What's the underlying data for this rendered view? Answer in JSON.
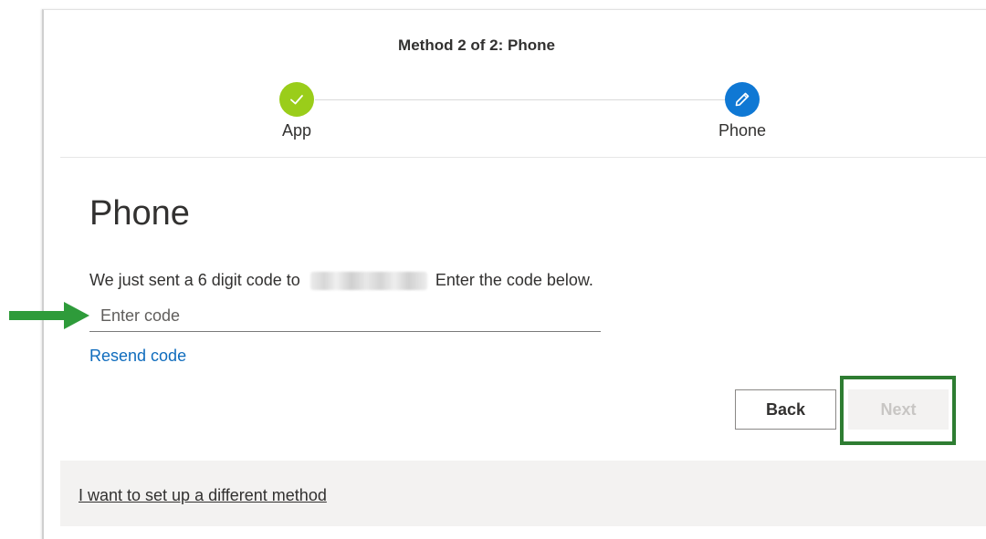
{
  "header": {
    "step_title": "Method 2 of 2: Phone",
    "steps": [
      {
        "label": "App",
        "status": "completed",
        "icon": "checkmark-icon",
        "color": "#9acd1a"
      },
      {
        "label": "Phone",
        "status": "current",
        "icon": "pencil-icon",
        "color": "#0f78d4"
      }
    ]
  },
  "main": {
    "title": "Phone",
    "instruction_prefix": "We just sent a 6 digit code to",
    "instruction_suffix": "Enter the code below.",
    "code_input": {
      "value": "",
      "placeholder": "Enter code"
    },
    "resend_label": "Resend code"
  },
  "buttons": {
    "back_label": "Back",
    "next_label": "Next"
  },
  "footer": {
    "link_label": "I want to set up a different method"
  },
  "annotations": {
    "arrow_icon": "right-arrow-icon",
    "arrow_color": "#2e9b3a",
    "highlight_color": "#2e7d32"
  }
}
